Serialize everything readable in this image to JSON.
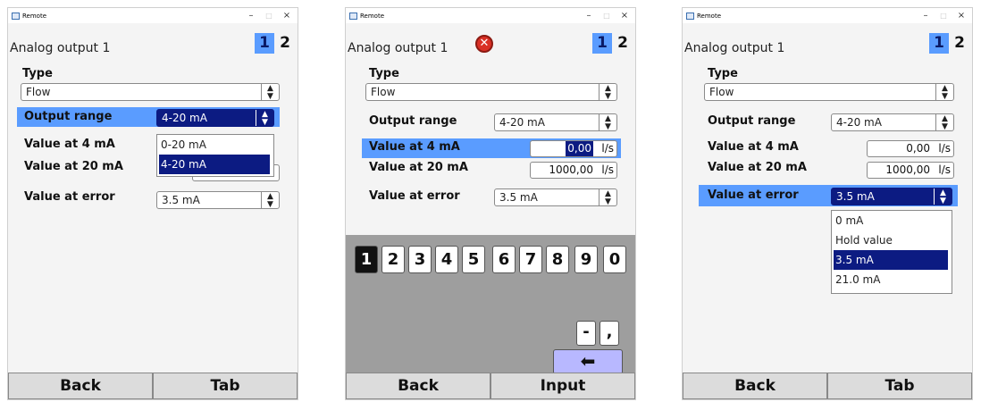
{
  "windows": [
    {
      "titlebar": {
        "title": "Remote",
        "min": "–",
        "max": "□",
        "close": "×"
      },
      "header": {
        "title": "Analog output 1",
        "tab1": "1",
        "tab2": "2"
      },
      "fields": {
        "type_label": "Type",
        "type_value": "Flow",
        "output_range_label": "Output range",
        "output_range_value": "4-20 mA",
        "value4_label": "Value at 4 mA",
        "value20_label": "Value at 20 mA",
        "error_label": "Value at error",
        "error_value": "3.5 mA"
      },
      "dropdown": {
        "options": [
          "0-20 mA",
          "4-20 mA"
        ],
        "selected": "4-20 mA"
      },
      "buttons": {
        "left": "Back",
        "right": "Tab"
      }
    },
    {
      "titlebar": {
        "title": "Remote",
        "min": "–",
        "max": "□",
        "close": "×"
      },
      "header": {
        "title": "Analog output 1",
        "error_icon": "error-icon",
        "tab1": "1",
        "tab2": "2"
      },
      "fields": {
        "type_label": "Type",
        "type_value": "Flow",
        "output_range_label": "Output range",
        "output_range_value": "4-20 mA",
        "value4_label": "Value at 4 mA",
        "value4_value": "0,00",
        "value4_unit": "l/s",
        "value20_label": "Value at 20 mA",
        "value20_value": "1000,00",
        "value20_unit": "l/s",
        "error_label": "Value at error",
        "error_value": "3.5 mA"
      },
      "keypad": {
        "digits": [
          "1",
          "2",
          "3",
          "4",
          "5",
          "6",
          "7",
          "8",
          "9",
          "0"
        ],
        "active": "1",
        "minus": "-",
        "comma": ",",
        "enter": "🡐"
      },
      "buttons": {
        "left": "Back",
        "right": "Input"
      }
    },
    {
      "titlebar": {
        "title": "Remote",
        "min": "–",
        "max": "□",
        "close": "×"
      },
      "header": {
        "title": "Analog output 1",
        "tab1": "1",
        "tab2": "2"
      },
      "fields": {
        "type_label": "Type",
        "type_value": "Flow",
        "output_range_label": "Output range",
        "output_range_value": "4-20 mA",
        "value4_label": "Value at 4 mA",
        "value4_value": "0,00",
        "value4_unit": "l/s",
        "value20_label": "Value at 20 mA",
        "value20_value": "1000,00",
        "value20_unit": "l/s",
        "error_label": "Value at error",
        "error_value": "3.5 mA"
      },
      "dropdown": {
        "options": [
          "0 mA",
          "Hold value",
          "3.5 mA",
          "21.0 mA"
        ],
        "selected": "3.5 mA"
      },
      "buttons": {
        "left": "Back",
        "right": "Tab"
      }
    }
  ],
  "colors": {
    "highlight": "#5a9cff",
    "selected": "#0c1b82",
    "keypad_bg": "#9e9e9e",
    "enter_key": "#b8b8ff",
    "error": "#d93025"
  },
  "icons": {
    "updown": "⬍",
    "error": "✕"
  }
}
